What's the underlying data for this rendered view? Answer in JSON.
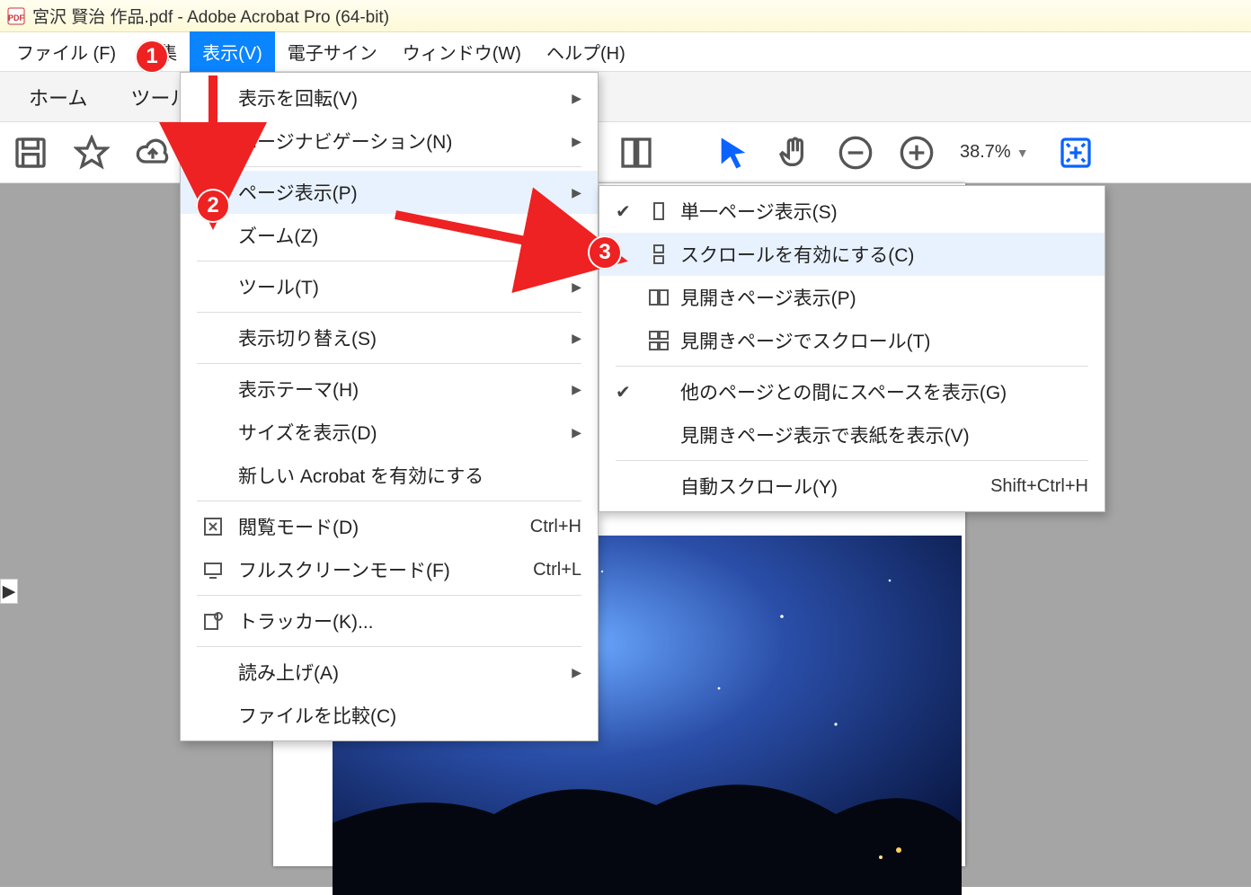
{
  "window": {
    "title": "宮沢 賢治 作品.pdf - Adobe Acrobat Pro (64-bit)"
  },
  "menubar": {
    "file": "ファイル (F)",
    "edit": "編集",
    "view": "表示(V)",
    "esign": "電子サイン",
    "window": "ウィンドウ(W)",
    "help": "ヘルプ(H)"
  },
  "tabs": {
    "home": "ホーム",
    "tools": "ツール"
  },
  "toolbar": {
    "zoom": "38.7%"
  },
  "view_menu": {
    "rotate": "表示を回転(V)",
    "page_nav": "ページナビゲーション(N)",
    "page_display": "ページ表示(P)",
    "zoom": "ズーム(Z)",
    "tools": "ツール(T)",
    "show_hide": "表示切り替え(S)",
    "theme": "表示テーマ(H)",
    "size": "サイズを表示(D)",
    "new_acrobat": "新しい Acrobat を有効にする",
    "reading_mode": "閲覧モード(D)",
    "reading_mode_short": "Ctrl+H",
    "fullscreen": "フルスクリーンモード(F)",
    "fullscreen_short": "Ctrl+L",
    "tracker": "トラッカー(K)...",
    "read_aloud": "読み上げ(A)",
    "compare": "ファイルを比較(C)"
  },
  "page_display_submenu": {
    "single": "単一ページ表示(S)",
    "enable_scroll": "スクロールを有効にする(C)",
    "two_page": "見開きページ表示(P)",
    "two_page_scroll": "見開きページでスクロール(T)",
    "gaps": "他のページとの間にスペースを表示(G)",
    "cover": "見開きページ表示で表紙を表示(V)",
    "auto_scroll": "自動スクロール(Y)",
    "auto_scroll_short": "Shift+Ctrl+H"
  },
  "callouts": {
    "c1": "1",
    "c2": "2",
    "c3": "3"
  }
}
